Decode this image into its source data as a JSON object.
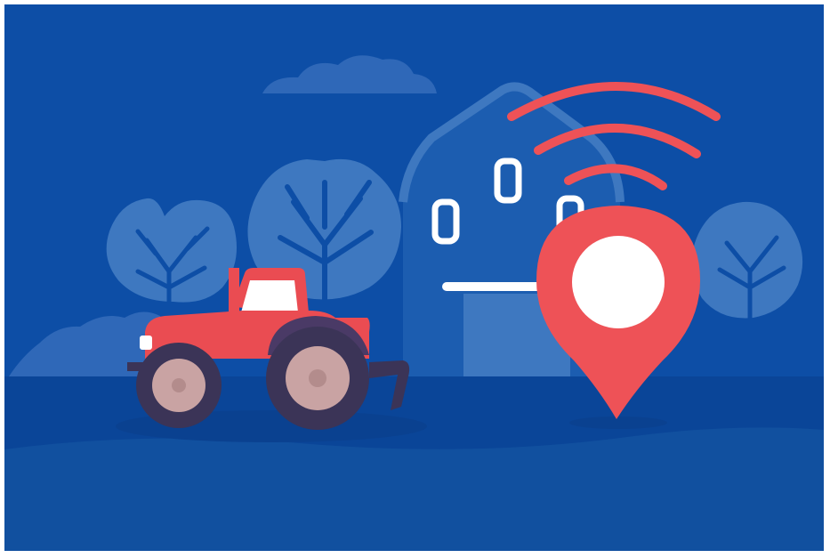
{
  "colors": {
    "background": "#0d4ea6",
    "ground_dark": "#0a4598",
    "ground_mid": "#11509f",
    "silhouette": "#3e78c0",
    "silhouette_light": "#4a84c8",
    "tree_trunk": "#0d4ea6",
    "barn_body": "#1c5db0",
    "barn_window": "#ffffff",
    "tractor_red": "#ea4c52",
    "tractor_dark": "#4a3a66",
    "tire": "#3b3457",
    "hub": "#c9a3a3",
    "pin_red": "#ee5257",
    "pin_center": "#ffffff",
    "signal_red": "#ee5257"
  },
  "icons": {
    "scene": "farm-gps-tracking-illustration",
    "tractor": "tractor-icon",
    "pin": "location-pin-icon",
    "signal": "wireless-signal-icon",
    "barn": "barn-icon",
    "trees": "tree-icon",
    "cloud": "cloud-icon"
  }
}
